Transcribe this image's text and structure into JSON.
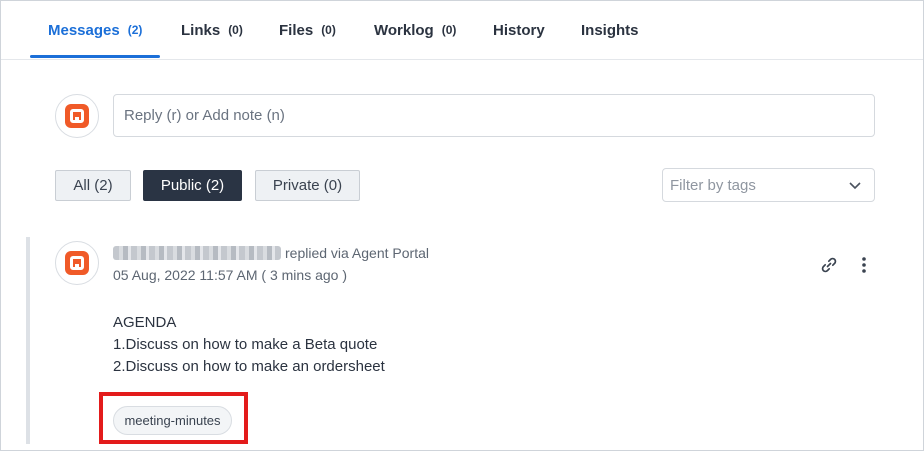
{
  "tabs": [
    {
      "label": "Messages",
      "count": "(2)"
    },
    {
      "label": "Links",
      "count": "(0)"
    },
    {
      "label": "Files",
      "count": "(0)"
    },
    {
      "label": "Worklog",
      "count": "(0)"
    },
    {
      "label": "History",
      "count": ""
    },
    {
      "label": "Insights",
      "count": ""
    }
  ],
  "reply": {
    "placeholder": "Reply (r) or Add note (n)"
  },
  "filters": {
    "all": "All (2)",
    "public": "Public (2)",
    "private": "Private (0)",
    "active": "Public (2)"
  },
  "tag_filter": {
    "placeholder": "Filter by tags"
  },
  "message": {
    "action": "replied via Agent Portal",
    "timestamp": "05 Aug, 2022 11:57 AM ( 3 mins ago )",
    "body": [
      "AGENDA",
      "1.Discuss on how to make a Beta quote",
      "2.Discuss on how to make an ordersheet"
    ],
    "tag": "meeting-minutes"
  },
  "colors": {
    "accent": "#1b6fd8",
    "brand_logo": "#f05a28",
    "active_filter": "#2a3444",
    "highlight": "#e31b1b"
  },
  "icons": [
    "brand-logo-icon",
    "chevron-down-icon",
    "link-icon",
    "more-vertical-icon"
  ]
}
